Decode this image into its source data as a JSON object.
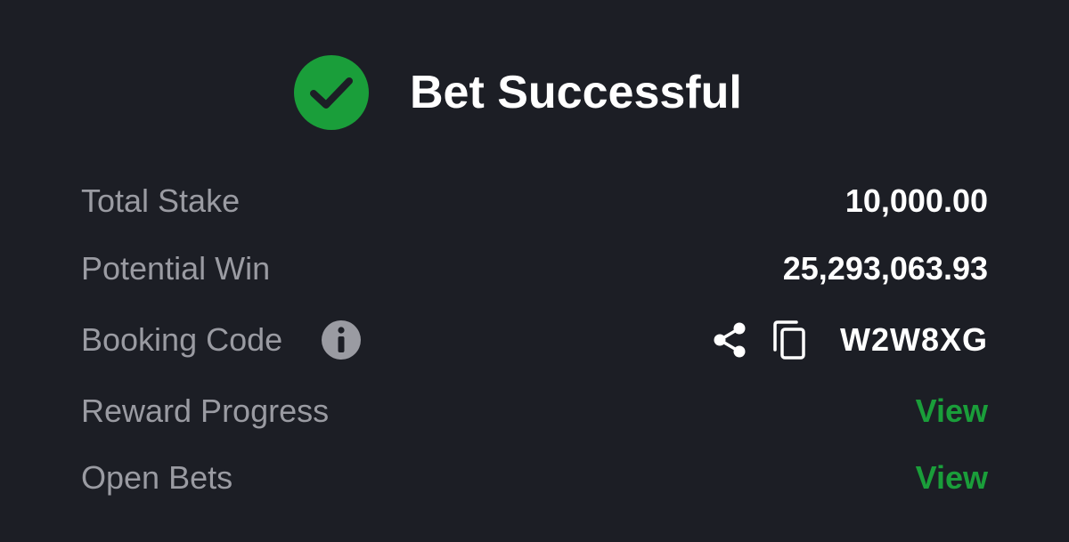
{
  "header": {
    "title": "Bet Successful",
    "status_icon": "check-circle-icon",
    "status_color": "#1a9e3a"
  },
  "details": {
    "total_stake": {
      "label": "Total Stake",
      "value": "10,000.00"
    },
    "potential_win": {
      "label": "Potential Win",
      "value": "25,293,063.93"
    },
    "booking_code": {
      "label": "Booking Code",
      "info_icon": "info-icon",
      "share_icon": "share-icon",
      "copy_icon": "copy-icon",
      "value": "W2W8XG"
    },
    "reward_progress": {
      "label": "Reward Progress",
      "link": "View"
    },
    "open_bets": {
      "label": "Open Bets",
      "link": "View"
    }
  },
  "colors": {
    "background": "#1c1e25",
    "label": "#9a9ba2",
    "value": "#ffffff",
    "link": "#1a9e3a"
  }
}
